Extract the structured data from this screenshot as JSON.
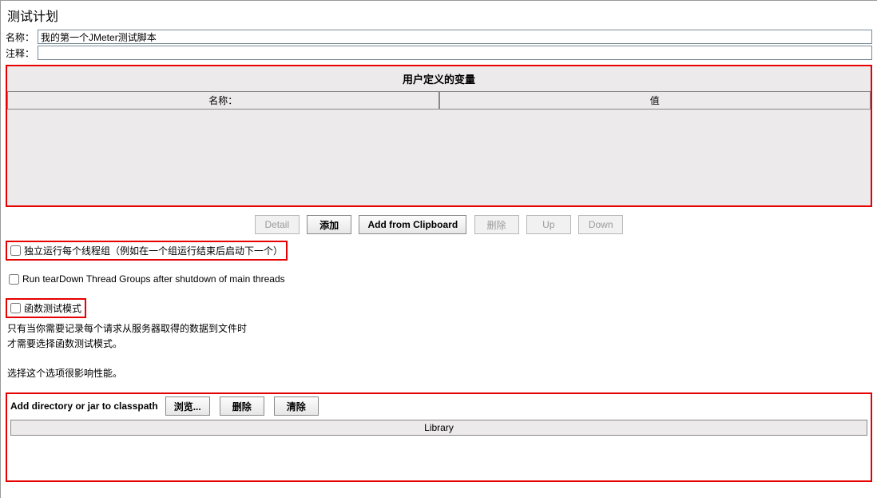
{
  "title": "测试计划",
  "fields": {
    "name_label": "名称：",
    "name_value": "我的第一个JMeter测试脚本",
    "comment_label": "注释：",
    "comment_value": ""
  },
  "user_vars": {
    "title": "用户定义的变量",
    "col_name": "名称：",
    "col_value": "值"
  },
  "buttons": {
    "detail": "Detail",
    "add": "添加",
    "add_clip": "Add from Clipboard",
    "delete": "删除",
    "up": "Up",
    "down": "Down"
  },
  "checks": {
    "consecutive": "独立运行每个线程组（例如在一个组运行结束后启动下一个）",
    "teardown": "Run tearDown Thread Groups after shutdown of main threads",
    "funcmode": "函数测试模式"
  },
  "desc": {
    "line1": "只有当你需要记录每个请求从服务器取得的数据到文件时",
    "line2": "才需要选择函数测试模式。",
    "line3": "选择这个选项很影响性能。"
  },
  "classpath": {
    "label": "Add directory or jar to classpath",
    "browse": "浏览...",
    "delete": "删除",
    "clear": "清除",
    "lib_header": "Library"
  }
}
